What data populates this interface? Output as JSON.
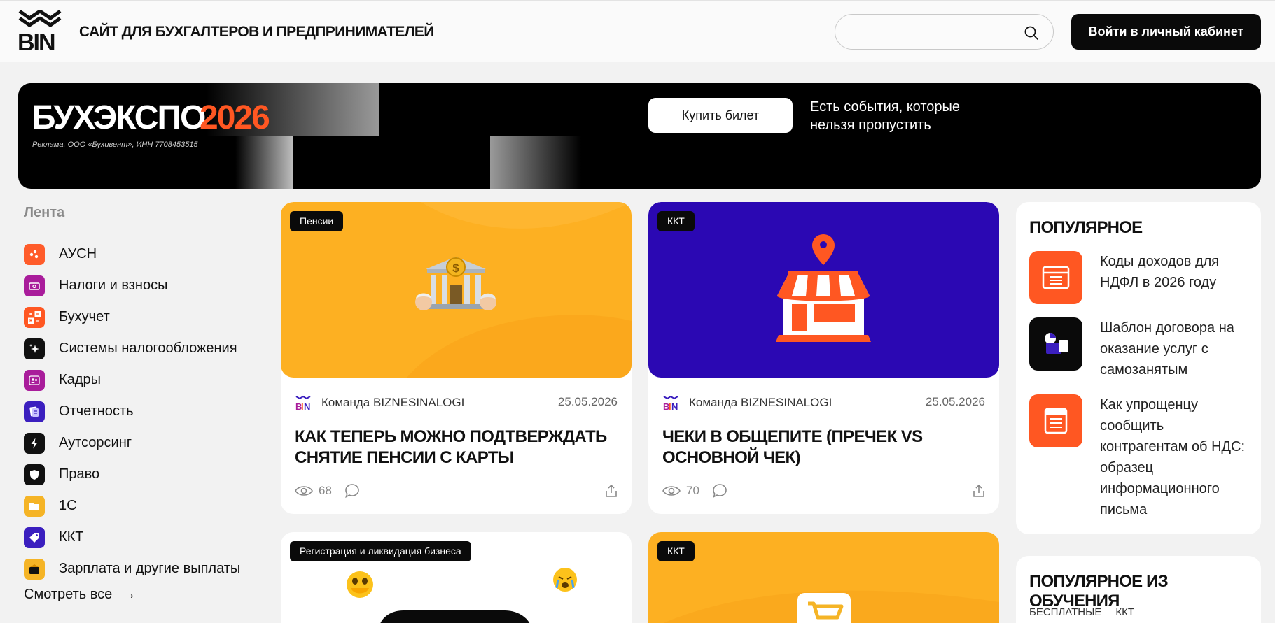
{
  "header": {
    "site_title": "Сайт для бухгалтеров и предпринимателей",
    "search_placeholder": "",
    "login_label": "Войти в личный кабинет"
  },
  "banner": {
    "title": "БУХЭКСПО",
    "year": "2026",
    "ad_note": "Реклама. ООО «Бухивент», ИНН 7708453515",
    "buy_label": "Купить билет",
    "tagline": "Есть события, которые нельзя пропустить",
    "accent_color": "#ff5722"
  },
  "sidebar": {
    "title": "Лента",
    "items": [
      {
        "label": "АУСН",
        "icon": "ausn-icon",
        "color": "#ff5c2b"
      },
      {
        "label": "Налоги и взносы",
        "icon": "taxes-icon",
        "color": "#a91d9b"
      },
      {
        "label": "Бухучет",
        "icon": "calculator-icon",
        "color": "#ff5722"
      },
      {
        "label": "Системы налогообложения",
        "icon": "sparkle-icon",
        "color": "#111111"
      },
      {
        "label": "Кадры",
        "icon": "people-icon",
        "color": "#a91d9b"
      },
      {
        "label": "Отчетность",
        "icon": "report-icon",
        "color": "#3b1fbf"
      },
      {
        "label": "Аутсорсинг",
        "icon": "lightning-icon",
        "color": "#111111"
      },
      {
        "label": "Право",
        "icon": "shield-icon",
        "color": "#111111"
      },
      {
        "label": "1С",
        "icon": "folder-icon",
        "color": "#f5b426"
      },
      {
        "label": "ККТ",
        "icon": "tag-icon",
        "color": "#3b1fbf"
      },
      {
        "label": "Зарплата и другие выплаты",
        "icon": "wallet-icon",
        "color": "#f5b426"
      }
    ],
    "see_all": "Смотреть все"
  },
  "cards": [
    {
      "tag": "Пенсии",
      "author": "Команда BIZNESINALOGI",
      "date": "25.05.2026",
      "title": "Как теперь можно подтверждать снятие пенсии с карты",
      "views": "68",
      "bg": "#fdb022",
      "image": "bank-with-pensioners-emoji"
    },
    {
      "tag": "ККТ",
      "author": "Команда BIZNESINALOGI",
      "date": "25.05.2026",
      "title": "Чеки в общепите (пречек vs основной чек)",
      "views": "70",
      "bg": "#2b08b3",
      "image": "shop-with-location-pin"
    }
  ],
  "cards_row2": [
    {
      "tag": "Регистрация и ликвидация бизнеса",
      "bg": "#ffffff"
    },
    {
      "tag": "ККТ",
      "bg": "#fdb022"
    }
  ],
  "popular": {
    "title": "Популярное",
    "items": [
      {
        "text": "Коды доходов для НДФЛ в 2026 году",
        "icon": "document-list-icon",
        "color": "#ff5722"
      },
      {
        "text": "Шаблон договора на оказание услуг с самозанятым",
        "icon": "contract-icon",
        "color": "#0a0a0a"
      },
      {
        "text": "Как упрощенцу сообщить контрагентам об НДС: образец информационного письма",
        "icon": "letter-icon",
        "color": "#ff5722"
      }
    ]
  },
  "popular_learning": {
    "title": "Популярное из обучения",
    "tabs": [
      "Бесплатные",
      "ККТ"
    ]
  }
}
